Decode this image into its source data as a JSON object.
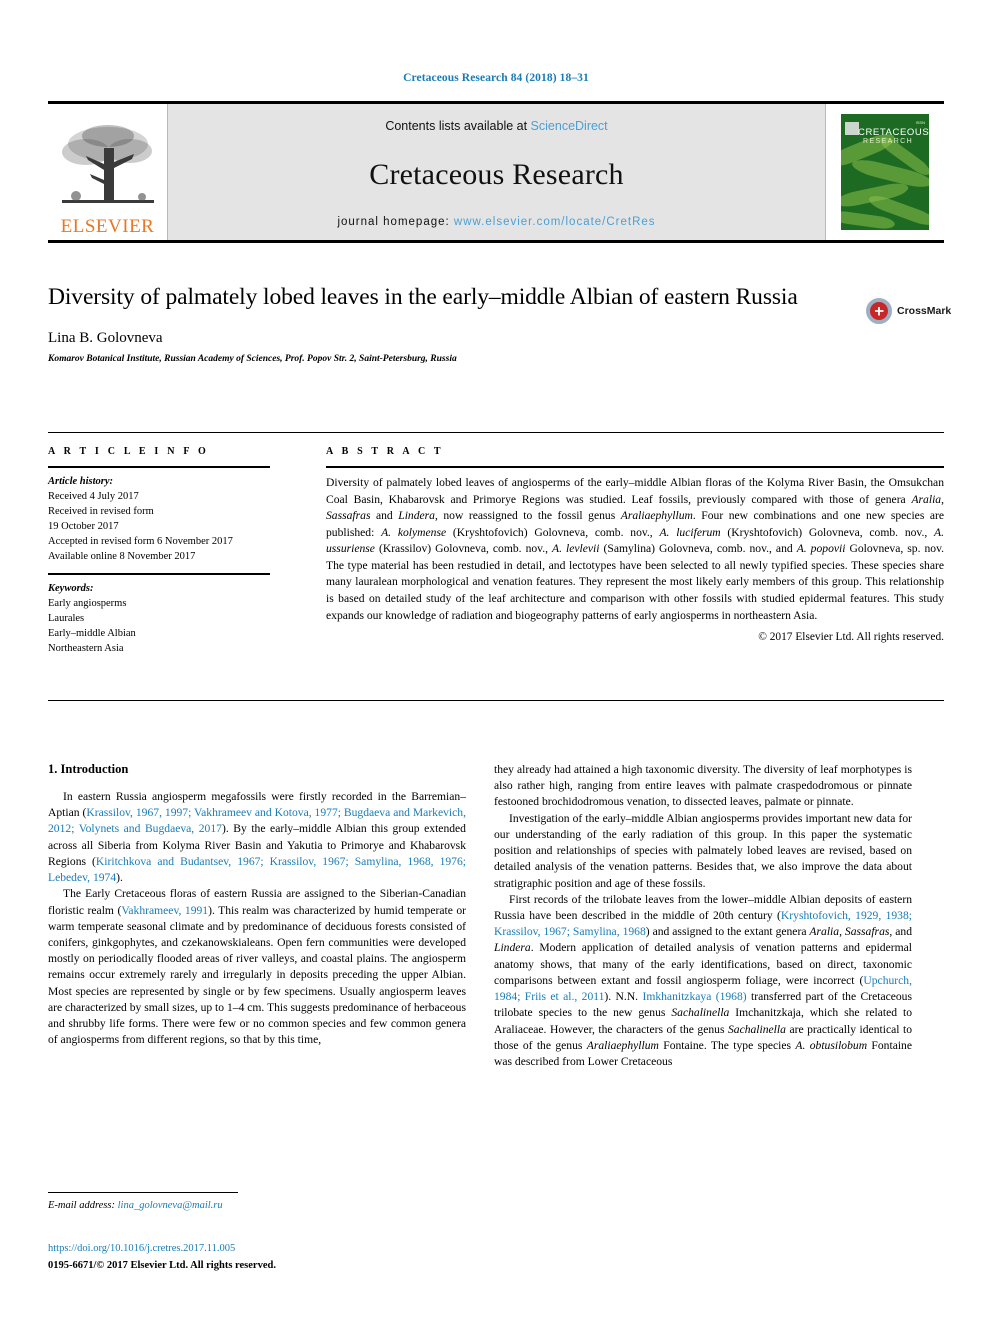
{
  "running_head": "Cretaceous Research 84 (2018) 18–31",
  "masthead": {
    "publisher_name": "ELSEVIER",
    "contents_prefix": "Contents lists available at ",
    "contents_link": "ScienceDirect",
    "journal_name": "Cretaceous Research",
    "homepage_prefix": "journal homepage: ",
    "homepage_url": "www.elsevier.com/locate/CretRes",
    "cover": {
      "title_line1": "CRETACEOUS",
      "title_line2": "RESEARCH"
    }
  },
  "article": {
    "title": "Diversity of palmately lobed leaves in the early–middle Albian of eastern Russia",
    "author": "Lina B. Golovneva",
    "affiliation": "Komarov Botanical Institute, Russian Academy of Sciences, Prof. Popov Str. 2, Saint-Petersburg, Russia",
    "crossmark_label": "CrossMark"
  },
  "article_info": {
    "heading": "A R T I C L E   I N F O",
    "history_label": "Article history:",
    "history": [
      "Received 4 July 2017",
      "Received in revised form",
      "19 October 2017",
      "Accepted in revised form 6 November 2017",
      "Available online 8 November 2017"
    ],
    "keywords_label": "Keywords:",
    "keywords": [
      "Early angiosperms",
      "Laurales",
      "Early–middle Albian",
      "Northeastern Asia"
    ]
  },
  "abstract": {
    "heading": "A B S T R A C T",
    "paragraphs": [
      "Diversity of palmately lobed leaves of angiosperms of the early–middle Albian floras of the Kolyma River Basin, the Omsukchan Coal Basin, Khabarovsk and Primorye Regions was studied. Leaf fossils, previously compared with those of genera <i>Aralia</i>, <i>Sassafras</i> and <i>Lindera</i>, now reassigned to the fossil genus <i>Araliaephyllum</i>. Four new combinations and one new species are published: <i>A. kolymense</i> (Kryshtofovich) Golovneva, comb. nov., <i>A. luciferum</i> (Kryshtofovich) Golovneva, comb. nov., <i>A. ussuriense</i> (Krassilov) Golovneva, comb. nov., <i>A. levlevii</i> (Samylina) Golovneva, comb. nov., and <i>A. popovii</i> Golovneva, sp. nov. The type material has been restudied in detail, and lectotypes have been selected to all newly typified species. These species share many lauralean morphological and venation features. They represent the most likely early members of this group. This relationship is based on detailed study of the leaf architecture and comparison with other fossils with studied epidermal features. This study expands our knowledge of radiation and biogeography patterns of early angiosperms in northeastern Asia."
    ],
    "copyright": "© 2017 Elsevier Ltd. All rights reserved."
  },
  "body": {
    "section_heading": "1. Introduction",
    "left_paragraphs": [
      "In eastern Russia angiosperm megafossils were firstly recorded in the Barremian–Aptian (<span class=\"ref\">Krassilov, 1967, 1997; Vakhrameev and Kotova, 1977; Bugdaeva and Markevich, 2012; Volynets and Bugdaeva, 2017</span>). By the early–middle Albian this group extended across all Siberia from Kolyma River Basin and Yakutia to Primorye and Khabarovsk Regions (<span class=\"ref\">Kiritchkova and Budantsev, 1967; Krassilov, 1967; Samylina, 1968, 1976; Lebedev, 1974</span>).",
      "The Early Cretaceous floras of eastern Russia are assigned to the Siberian-Canadian floristic realm (<span class=\"ref\">Vakhrameev, 1991</span>). This realm was characterized by humid temperate or warm temperate seasonal climate and by predominance of deciduous forests consisted of conifers, ginkgophytes, and czekanowskialeans. Open fern communities were developed mostly on periodically flooded areas of river valleys, and coastal plains. The angiosperm remains occur extremely rarely and irregularly in deposits preceding the upper Albian. Most species are represented by single or by few specimens. Usually angiosperm leaves are characterized by small sizes, up to 1–4 cm. This suggests predominance of herbaceous and shrubby life forms. There were few or no common species and few common genera of angiosperms from different regions, so that by this time,"
    ],
    "right_paragraphs": [
      "they already had attained a high taxonomic diversity. The diversity of leaf morphotypes is also rather high, ranging from entire leaves with palmate craspedodromous or pinnate festooned brochidodromous venation, to dissected leaves, palmate or pinnate.",
      "Investigation of the early–middle Albian angiosperms provides important new data for our understanding of the early radiation of this group. In this paper the systematic position and relationships of species with palmately lobed leaves are revised, based on detailed analysis of the venation patterns. Besides that, we also improve the data about stratigraphic position and age of these fossils.",
      "First records of the trilobate leaves from the lower–middle Albian deposits of eastern Russia have been described in the middle of 20th century (<span class=\"ref\">Kryshtofovich, 1929, 1938; Krassilov, 1967; Samylina, 1968</span>) and assigned to the extant genera <i>Aralia</i>, <i>Sassafras</i>, and <i>Lindera</i>. Modern application of detailed analysis of venation patterns and epidermal anatomy shows, that many of the early identifications, based on direct, taxonomic comparisons between extant and fossil angiosperm foliage, were incorrect (<span class=\"ref\">Upchurch, 1984; Friis et al., 2011</span>). N.N. <span class=\"ref\">Imkhanitzkaya (1968)</span> transferred part of the Cretaceous trilobate species to the new genus <i>Sachalinella</i> Imchanitzkaja, which she related to Araliaceae. However, the characters of the genus <i>Sachalinella</i> are practically identical to those of the genus <i>Araliaephyllum</i> Fontaine. The type species <i>A. obtusilobum</i> Fontaine was described from Lower Cretaceous"
    ]
  },
  "footer": {
    "email_label": "E-mail address:",
    "email": "lina_golovneva@mail.ru",
    "doi": "https://doi.org/10.1016/j.cretres.2017.11.005",
    "issn_copyright": "0195-6671/© 2017 Elsevier Ltd. All rights reserved."
  },
  "colors": {
    "link_blue": "#1a7cb7",
    "science_direct_blue": "#4b9fd5",
    "elsevier_orange": "#e87722",
    "masthead_grey": "#e4e4e4"
  }
}
